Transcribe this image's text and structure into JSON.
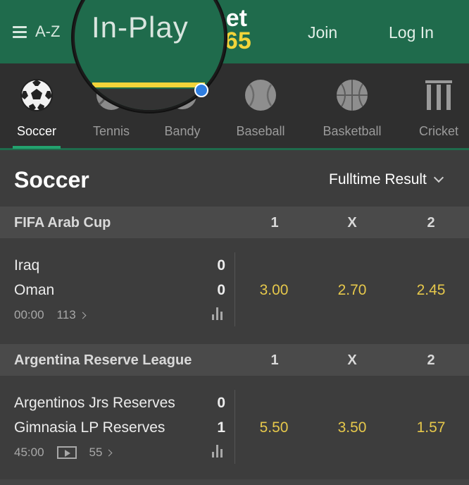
{
  "header": {
    "menu_label": "A-Z",
    "logo_line1": "bet",
    "logo_line2": "365",
    "join_label": "Join",
    "login_label": "Log In"
  },
  "magnifier": {
    "label": "In-Play"
  },
  "sports": [
    {
      "label": "Soccer",
      "icon": "soccer-ball-icon"
    },
    {
      "label": "Tennis",
      "icon": "tennis-ball-icon"
    },
    {
      "label": "Bandy",
      "icon": "bandy-ball-icon"
    },
    {
      "label": "Baseball",
      "icon": "baseball-icon"
    },
    {
      "label": "Basketball",
      "icon": "basketball-icon"
    },
    {
      "label": "Cricket",
      "icon": "cricket-stumps-icon"
    }
  ],
  "section": {
    "title": "Soccer",
    "market_selector": "Fulltime Result"
  },
  "competitions": [
    {
      "name": "FIFA Arab Cup",
      "col1": "1",
      "colx": "X",
      "col2": "2",
      "match": {
        "home": "Iraq",
        "away": "Oman",
        "home_score": "0",
        "away_score": "0",
        "time": "00:00",
        "markets_count": "113",
        "odds1": "3.00",
        "oddsx": "2.70",
        "odds2": "2.45"
      }
    },
    {
      "name": "Argentina Reserve League",
      "col1": "1",
      "colx": "X",
      "col2": "2",
      "match": {
        "home": "Argentinos Jrs Reserves",
        "away": "Gimnasia LP Reserves",
        "home_score": "0",
        "away_score": "1",
        "time": "45:00",
        "markets_count": "55",
        "odds1": "5.50",
        "oddsx": "3.50",
        "odds2": "1.57"
      }
    }
  ],
  "colors": {
    "header_green": "#1f6b4c",
    "accent_yellow": "#f2d43a",
    "odds_yellow": "#e6c84b",
    "active_underline": "#23a36f"
  }
}
